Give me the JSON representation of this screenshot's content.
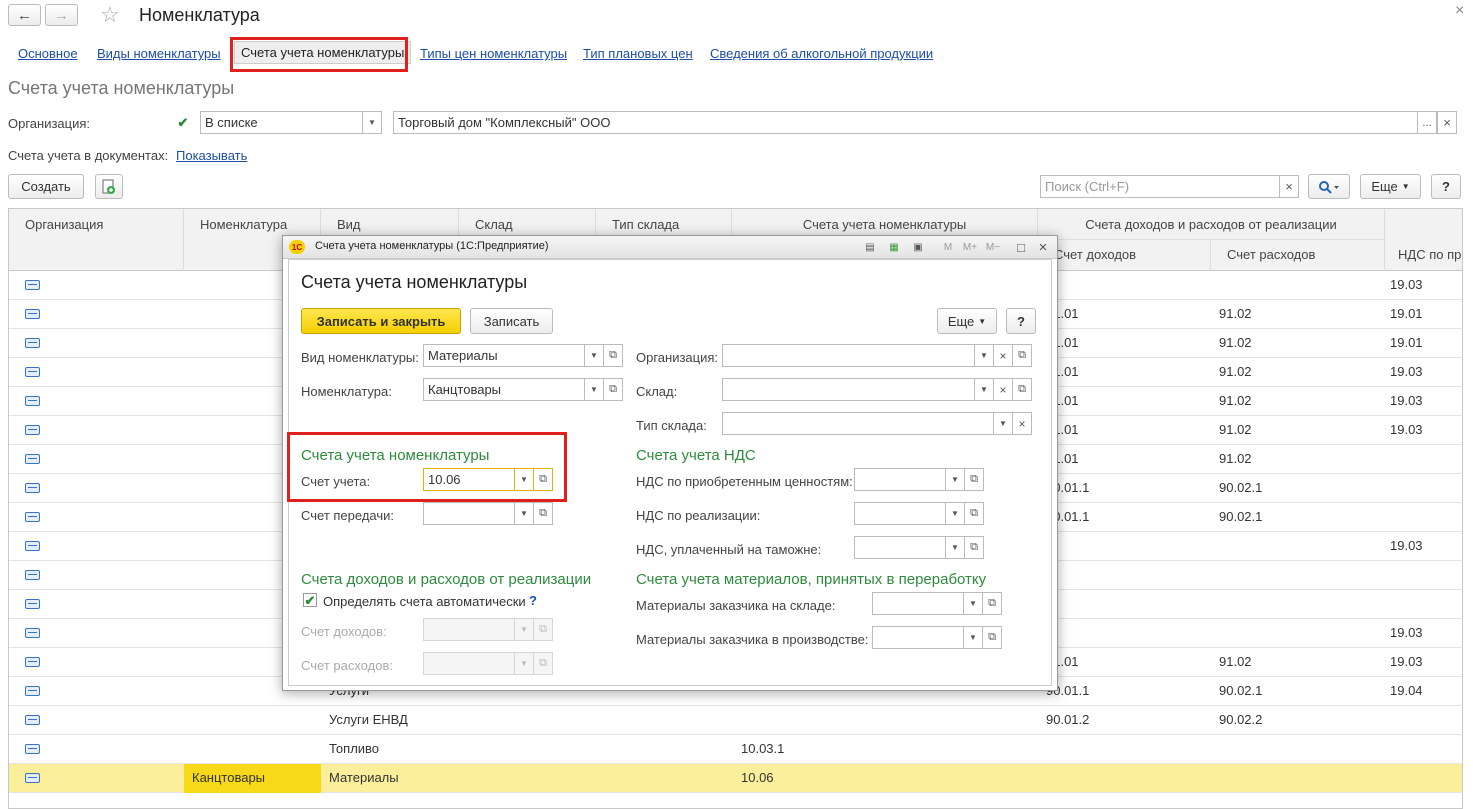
{
  "window": {
    "title": "Номенклатура"
  },
  "nav": {
    "back": "←",
    "forward": "→",
    "star": "☆",
    "close": "×"
  },
  "tabs": [
    {
      "label": "Основное"
    },
    {
      "label": "Виды номенклатуры"
    },
    {
      "label": "Счета учета номенклатуры"
    },
    {
      "label": "Типы цен номенклатуры"
    },
    {
      "label": "Тип плановых цен"
    },
    {
      "label": "Сведения об алкогольной продукции"
    }
  ],
  "section_title": "Счета учета номенклатуры",
  "filter": {
    "org_label": "Организация:",
    "org_mode": "В списке",
    "org_value": "Торговый дом \"Комплексный\" ООО",
    "dots": "...",
    "clear": "×",
    "docs_label": "Счета учета в документах:",
    "docs_link": "Показывать"
  },
  "toolbar": {
    "create": "Создать",
    "search_placeholder": "Поиск (Ctrl+F)",
    "search_clear": "×",
    "more": "Еще",
    "help": "?"
  },
  "grid": {
    "headers": {
      "org": "Организация",
      "nomenclature": "Номенклатура",
      "kind": "Вид",
      "warehouse": "Склад",
      "warehouse_type": "Тип склада",
      "accounts_group": "Счета учета номенклатуры",
      "income_group": "Счета доходов и расходов от реализации",
      "income": "Счет доходов",
      "expense": "Счет расходов",
      "vat": "НДС по пр"
    },
    "rows": [
      {
        "nomenclature": "",
        "kind": "",
        "account": "",
        "income": "",
        "expense": "",
        "vat": "19.03"
      },
      {
        "nomenclature": "",
        "kind": "",
        "account": "",
        "income": "91.01",
        "expense": "91.02",
        "vat": "19.01"
      },
      {
        "nomenclature": "",
        "kind": "",
        "account": "",
        "income": "91.01",
        "expense": "91.02",
        "vat": "19.01"
      },
      {
        "nomenclature": "",
        "kind": "",
        "account": "",
        "income": "91.01",
        "expense": "91.02",
        "vat": "19.03"
      },
      {
        "nomenclature": "",
        "kind": "",
        "account": "",
        "income": "91.01",
        "expense": "91.02",
        "vat": "19.03"
      },
      {
        "nomenclature": "",
        "kind": "",
        "account": "",
        "income": "91.01",
        "expense": "91.02",
        "vat": "19.03"
      },
      {
        "nomenclature": "",
        "kind": "",
        "account": "",
        "income": "91.01",
        "expense": "91.02",
        "vat": ""
      },
      {
        "nomenclature": "",
        "kind": "",
        "account": "",
        "income": "90.01.1",
        "expense": "90.02.1",
        "vat": ""
      },
      {
        "nomenclature": "",
        "kind": "",
        "account": "",
        "income": "90.01.1",
        "expense": "90.02.1",
        "vat": ""
      },
      {
        "nomenclature": "",
        "kind": "",
        "account": "",
        "income": "",
        "expense": "",
        "vat": "19.03"
      },
      {
        "nomenclature": "",
        "kind": "",
        "account": "",
        "income": "",
        "expense": "",
        "vat": ""
      },
      {
        "nomenclature": "",
        "kind": "",
        "account": "",
        "income": "",
        "expense": "",
        "vat": ""
      },
      {
        "nomenclature": "",
        "kind": "",
        "account": "",
        "income": "",
        "expense": "",
        "vat": "19.03"
      },
      {
        "nomenclature": "",
        "kind": "",
        "account": "",
        "income": "91.01",
        "expense": "91.02",
        "vat": "19.03"
      },
      {
        "nomenclature": "",
        "kind": "Услуги",
        "account": "",
        "income": "90.01.1",
        "expense": "90.02.1",
        "vat": "19.04"
      },
      {
        "nomenclature": "",
        "kind": "Услуги ЕНВД",
        "account": "",
        "income": "90.01.2",
        "expense": "90.02.2",
        "vat": ""
      },
      {
        "nomenclature": "",
        "kind": "Топливо",
        "account": "10.03.1",
        "income": "",
        "expense": "",
        "vat": ""
      },
      {
        "nomenclature": "Канцтовары",
        "kind": "Материалы",
        "account": "10.06",
        "income": "",
        "expense": "",
        "vat": ""
      }
    ]
  },
  "dialog": {
    "window_title": "Счета учета номенклатуры  (1С:Предприятие)",
    "logo": "1С",
    "header_icons": [
      "M",
      "M+",
      "M−",
      "□",
      "×"
    ],
    "title": "Счета учета номенклатуры",
    "save_close": "Записать и закрыть",
    "save": "Записать",
    "more": "Еще",
    "help": "?",
    "kind_label": "Вид номенклатуры:",
    "kind_value": "Материалы",
    "nom_label": "Номенклатура:",
    "nom_value": "Канцтовары",
    "org_label": "Организация:",
    "org_value": "",
    "wh_label": "Склад:",
    "wh_value": "",
    "whtype_label": "Тип склада:",
    "whtype_value": "",
    "accounts_section": "Счета учета номенклатуры",
    "account_label": "Счет учета:",
    "account_value": "10.06",
    "transfer_label": "Счет передачи:",
    "transfer_value": "",
    "income_section": "Счета доходов и расходов от реализации",
    "auto_label": "Определять счета автоматически",
    "auto_help": "?",
    "income_label": "Счет доходов:",
    "expense_label": "Счет расходов:",
    "vat_section": "Счета учета НДС",
    "vat_acquired_label": "НДС по приобретенным ценностям:",
    "vat_sales_label": "НДС по реализации:",
    "vat_customs_label": "НДС, уплаченный на таможне:",
    "materials_section": "Счета учета материалов, принятых в переработку",
    "mat_wh_label": "Материалы заказчика на складе:",
    "mat_prod_label": "Материалы заказчика в производстве:"
  }
}
